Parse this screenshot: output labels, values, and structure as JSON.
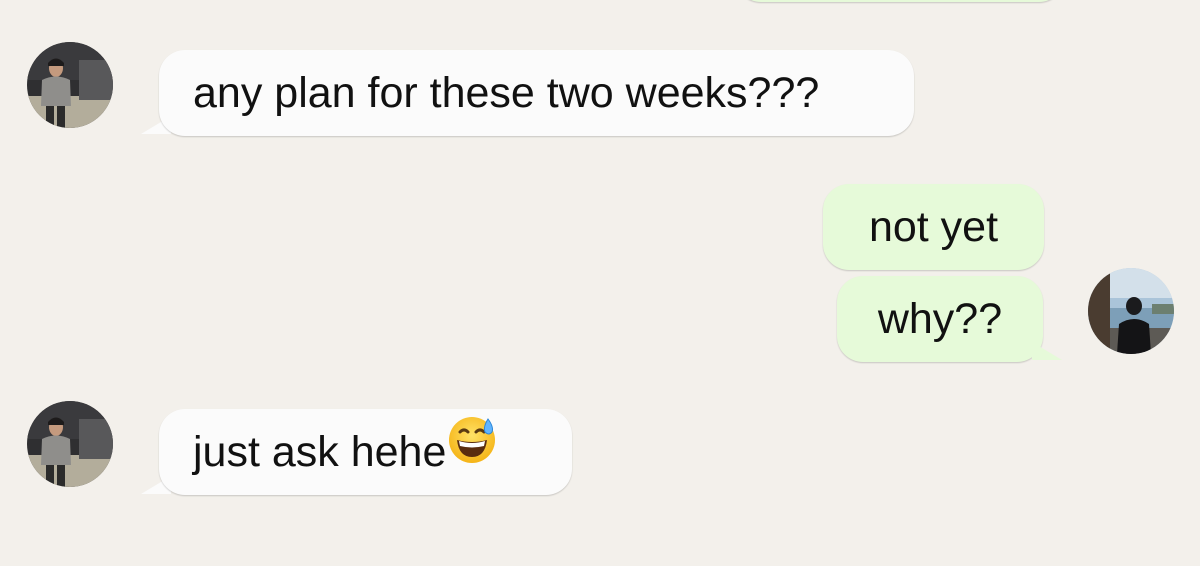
{
  "chat": {
    "messages": [
      {
        "direction": "incoming",
        "text": "any plan for these two weeks???"
      },
      {
        "direction": "outgoing",
        "text": "not yet"
      },
      {
        "direction": "outgoing",
        "text": "why??"
      },
      {
        "direction": "incoming",
        "text": "just ask hehe",
        "emoji": "grinning-face-with-sweat"
      }
    ],
    "contact_avatar": {
      "icon": "person-photo-avatar"
    },
    "user_avatar": {
      "icon": "person-sea-photo-avatar"
    },
    "colors": {
      "background": "#f3f0eb",
      "incoming_bubble": "#fbfbfb",
      "outgoing_bubble": "#e6fad9",
      "text": "#111111"
    }
  }
}
